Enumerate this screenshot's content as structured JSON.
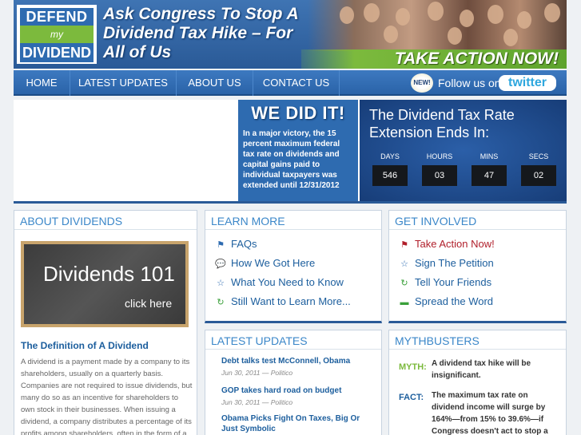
{
  "header": {
    "logo_line1": "DEFEND",
    "logo_line2": "my",
    "logo_line3": "DIVIDEND",
    "headline": "Ask Congress To Stop A Dividend Tax Hike – For All of Us",
    "take_action": "TAKE ACTION NOW!"
  },
  "nav": {
    "items": [
      "HOME",
      "LATEST UPDATES",
      "ABOUT US",
      "CONTACT US"
    ],
    "new_badge": "NEW!",
    "follow_text": "Follow us on",
    "twitter": "twitter"
  },
  "hero": {
    "we_did_title": "WE DID IT!",
    "we_did_text": "In a major victory, the 15 percent maximum federal tax rate on dividends and capital gains paid to individual taxpayers was extended until 12/31/2012",
    "countdown_title": "The Dividend Tax Rate Extension Ends In:",
    "units": [
      "DAYS",
      "HOURS",
      "MINS",
      "SECS"
    ],
    "values": [
      "546",
      "03",
      "47",
      "02"
    ]
  },
  "about": {
    "title": "ABOUT DIVIDENDS",
    "chalk_title": "Dividends 101",
    "chalk_click": "click here",
    "definition_title": "The Definition of A Dividend",
    "definition_text": "A dividend is a payment made by a company to its shareholders, usually on a quarterly basis. Companies are not required to issue dividends, but many do so as an incentive for shareholders to own stock in their businesses. When issuing a dividend, a company distributes a percentage of its profits among shareholders, often in the form of a"
  },
  "learn": {
    "title": "LEARN MORE",
    "links": [
      "FAQs",
      "How We Got Here",
      "What You Need to Know",
      "Still Want to Learn More..."
    ]
  },
  "involved": {
    "title": "GET INVOLVED",
    "links": [
      "Take Action Now!",
      "Sign The Petition",
      "Tell Your Friends",
      "Spread the Word"
    ]
  },
  "latest": {
    "title": "LATEST UPDATES",
    "items": [
      {
        "title": "Debt talks test McConnell, Obama",
        "meta": "Jun 30, 2011 — Politico"
      },
      {
        "title": "GOP takes hard road on budget",
        "meta": "Jun 30, 2011 — Politico"
      },
      {
        "title": "Obama Picks Fight On Taxes, Big Or Just Symbolic",
        "meta": ""
      }
    ]
  },
  "myth": {
    "title": "MYTHBUSTERS",
    "myth_label": "MYTH:",
    "myth_text": "A dividend tax hike will be insignificant.",
    "fact_label": "FACT:",
    "fact_text": "The maximum tax rate on dividend income will surge by 164%—from 15% to 39.6%—if Congress doesn't act to stop a"
  },
  "colors": {
    "brand_blue": "#2e6bb0",
    "brand_green": "#7cba3d",
    "link_blue": "#1c5e9d",
    "alert_red": "#b01e2a"
  }
}
